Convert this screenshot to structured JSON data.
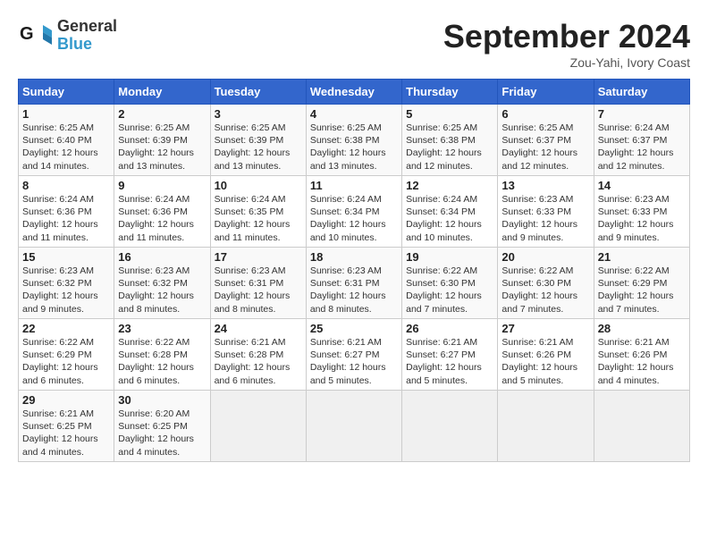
{
  "header": {
    "logo_line1": "General",
    "logo_line2": "Blue",
    "month": "September 2024",
    "location": "Zou-Yahi, Ivory Coast"
  },
  "weekdays": [
    "Sunday",
    "Monday",
    "Tuesday",
    "Wednesday",
    "Thursday",
    "Friday",
    "Saturday"
  ],
  "weeks": [
    [
      {
        "day": "1",
        "info": "Sunrise: 6:25 AM\nSunset: 6:40 PM\nDaylight: 12 hours\nand 14 minutes."
      },
      {
        "day": "2",
        "info": "Sunrise: 6:25 AM\nSunset: 6:39 PM\nDaylight: 12 hours\nand 13 minutes."
      },
      {
        "day": "3",
        "info": "Sunrise: 6:25 AM\nSunset: 6:39 PM\nDaylight: 12 hours\nand 13 minutes."
      },
      {
        "day": "4",
        "info": "Sunrise: 6:25 AM\nSunset: 6:38 PM\nDaylight: 12 hours\nand 13 minutes."
      },
      {
        "day": "5",
        "info": "Sunrise: 6:25 AM\nSunset: 6:38 PM\nDaylight: 12 hours\nand 12 minutes."
      },
      {
        "day": "6",
        "info": "Sunrise: 6:25 AM\nSunset: 6:37 PM\nDaylight: 12 hours\nand 12 minutes."
      },
      {
        "day": "7",
        "info": "Sunrise: 6:24 AM\nSunset: 6:37 PM\nDaylight: 12 hours\nand 12 minutes."
      }
    ],
    [
      {
        "day": "8",
        "info": "Sunrise: 6:24 AM\nSunset: 6:36 PM\nDaylight: 12 hours\nand 11 minutes."
      },
      {
        "day": "9",
        "info": "Sunrise: 6:24 AM\nSunset: 6:36 PM\nDaylight: 12 hours\nand 11 minutes."
      },
      {
        "day": "10",
        "info": "Sunrise: 6:24 AM\nSunset: 6:35 PM\nDaylight: 12 hours\nand 11 minutes."
      },
      {
        "day": "11",
        "info": "Sunrise: 6:24 AM\nSunset: 6:34 PM\nDaylight: 12 hours\nand 10 minutes."
      },
      {
        "day": "12",
        "info": "Sunrise: 6:24 AM\nSunset: 6:34 PM\nDaylight: 12 hours\nand 10 minutes."
      },
      {
        "day": "13",
        "info": "Sunrise: 6:23 AM\nSunset: 6:33 PM\nDaylight: 12 hours\nand 9 minutes."
      },
      {
        "day": "14",
        "info": "Sunrise: 6:23 AM\nSunset: 6:33 PM\nDaylight: 12 hours\nand 9 minutes."
      }
    ],
    [
      {
        "day": "15",
        "info": "Sunrise: 6:23 AM\nSunset: 6:32 PM\nDaylight: 12 hours\nand 9 minutes."
      },
      {
        "day": "16",
        "info": "Sunrise: 6:23 AM\nSunset: 6:32 PM\nDaylight: 12 hours\nand 8 minutes."
      },
      {
        "day": "17",
        "info": "Sunrise: 6:23 AM\nSunset: 6:31 PM\nDaylight: 12 hours\nand 8 minutes."
      },
      {
        "day": "18",
        "info": "Sunrise: 6:23 AM\nSunset: 6:31 PM\nDaylight: 12 hours\nand 8 minutes."
      },
      {
        "day": "19",
        "info": "Sunrise: 6:22 AM\nSunset: 6:30 PM\nDaylight: 12 hours\nand 7 minutes."
      },
      {
        "day": "20",
        "info": "Sunrise: 6:22 AM\nSunset: 6:30 PM\nDaylight: 12 hours\nand 7 minutes."
      },
      {
        "day": "21",
        "info": "Sunrise: 6:22 AM\nSunset: 6:29 PM\nDaylight: 12 hours\nand 7 minutes."
      }
    ],
    [
      {
        "day": "22",
        "info": "Sunrise: 6:22 AM\nSunset: 6:29 PM\nDaylight: 12 hours\nand 6 minutes."
      },
      {
        "day": "23",
        "info": "Sunrise: 6:22 AM\nSunset: 6:28 PM\nDaylight: 12 hours\nand 6 minutes."
      },
      {
        "day": "24",
        "info": "Sunrise: 6:21 AM\nSunset: 6:28 PM\nDaylight: 12 hours\nand 6 minutes."
      },
      {
        "day": "25",
        "info": "Sunrise: 6:21 AM\nSunset: 6:27 PM\nDaylight: 12 hours\nand 5 minutes."
      },
      {
        "day": "26",
        "info": "Sunrise: 6:21 AM\nSunset: 6:27 PM\nDaylight: 12 hours\nand 5 minutes."
      },
      {
        "day": "27",
        "info": "Sunrise: 6:21 AM\nSunset: 6:26 PM\nDaylight: 12 hours\nand 5 minutes."
      },
      {
        "day": "28",
        "info": "Sunrise: 6:21 AM\nSunset: 6:26 PM\nDaylight: 12 hours\nand 4 minutes."
      }
    ],
    [
      {
        "day": "29",
        "info": "Sunrise: 6:21 AM\nSunset: 6:25 PM\nDaylight: 12 hours\nand 4 minutes."
      },
      {
        "day": "30",
        "info": "Sunrise: 6:20 AM\nSunset: 6:25 PM\nDaylight: 12 hours\nand 4 minutes."
      },
      {
        "day": "",
        "info": ""
      },
      {
        "day": "",
        "info": ""
      },
      {
        "day": "",
        "info": ""
      },
      {
        "day": "",
        "info": ""
      },
      {
        "day": "",
        "info": ""
      }
    ]
  ]
}
